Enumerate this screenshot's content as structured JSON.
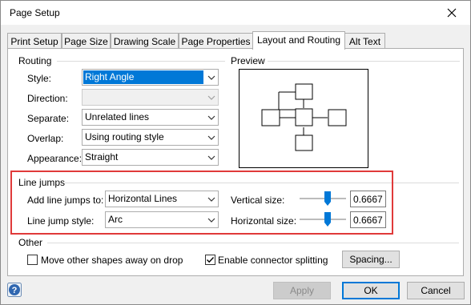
{
  "window": {
    "title": "Page Setup",
    "close_icon": "close-icon"
  },
  "tabs": [
    {
      "label": "Print Setup",
      "active": false
    },
    {
      "label": "Page Size",
      "active": false
    },
    {
      "label": "Drawing Scale",
      "active": false
    },
    {
      "label": "Page Properties",
      "active": false
    },
    {
      "label": "Layout and Routing",
      "active": true
    },
    {
      "label": "Alt Text",
      "active": false
    }
  ],
  "routing": {
    "heading": "Routing",
    "style_label": "Style:",
    "style_value": "Right Angle",
    "direction_label": "Direction:",
    "direction_value": "",
    "separate_label": "Separate:",
    "separate_value": "Unrelated lines",
    "overlap_label": "Overlap:",
    "overlap_value": "Using routing style",
    "appearance_label": "Appearance:",
    "appearance_value": "Straight"
  },
  "preview": {
    "heading": "Preview"
  },
  "line_jumps": {
    "heading": "Line jumps",
    "add_label": "Add line jumps to:",
    "add_value": "Horizontal Lines",
    "style_label": "Line jump style:",
    "style_value": "Arc",
    "vertical_label": "Vertical size:",
    "vertical_value": "0.6667",
    "vertical_slider_fraction": 0.6,
    "horizontal_label": "Horizontal size:",
    "horizontal_value": "0.6667",
    "horizontal_slider_fraction": 0.6
  },
  "other": {
    "heading": "Other",
    "move_shapes_label": "Move other shapes away on drop",
    "move_shapes_checked": false,
    "split_label": "Enable connector splitting",
    "split_checked": true,
    "spacing_button": "Spacing..."
  },
  "footer": {
    "help_icon": "help-icon",
    "apply_label": "Apply",
    "ok_label": "OK",
    "cancel_label": "Cancel"
  },
  "colors": {
    "accent": "#0078d7",
    "highlight": "#e03a3a",
    "slider_thumb": "#0078d7"
  }
}
